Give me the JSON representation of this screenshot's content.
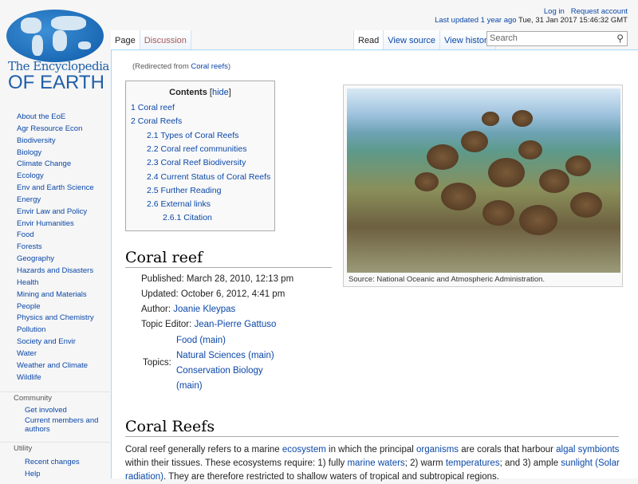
{
  "logo": {
    "line1": "The Encyclopedia",
    "line2": "OF EARTH"
  },
  "header": {
    "login": "Log in",
    "request_account": "Request account",
    "last_updated_label": "Last updated",
    "last_updated_ago": "1 year ago",
    "last_updated_date": "Tue, 31 Jan 2017 15:46:32 GMT"
  },
  "tabs": {
    "page": "Page",
    "discussion": "Discussion",
    "read": "Read",
    "view_source": "View source",
    "view_history": "View history"
  },
  "search": {
    "placeholder": "Search",
    "icon": "search-icon"
  },
  "sidebar": {
    "items": [
      "About the EoE",
      "Agr Resource Econ",
      "Biodiversity",
      "Biology",
      "Climate Change",
      "Ecology",
      "Env and Earth Science",
      "Energy",
      "Envir Law and Policy",
      "Envir Humanities",
      "Food",
      "Forests",
      "Geography",
      "Hazards and Disasters",
      "Health",
      "Mining and Materials",
      "People",
      "Physics and Chemistry",
      "Pollution",
      "Society and Envir",
      "Water",
      "Weather and Climate",
      "Wildlife"
    ],
    "community": {
      "heading": "Community",
      "items": [
        "Get involved",
        "Current members and authors"
      ]
    },
    "utility": {
      "heading": "Utility",
      "items": [
        "Recent changes",
        "Help"
      ]
    }
  },
  "redirect": {
    "prefix": "(Redirected from ",
    "link": "Coral reefs",
    "suffix": ")"
  },
  "toc": {
    "title": "Contents",
    "hide": "hide",
    "entries": [
      {
        "num": "1",
        "label": "Coral reef"
      },
      {
        "num": "2",
        "label": "Coral Reefs"
      },
      {
        "num": "2.1",
        "label": "Types of Coral Reefs"
      },
      {
        "num": "2.2",
        "label": "Coral reef communities"
      },
      {
        "num": "2.3",
        "label": "Coral Reef Biodiversity"
      },
      {
        "num": "2.4",
        "label": "Current Status of Coral Reefs"
      },
      {
        "num": "2.5",
        "label": "Further Reading"
      },
      {
        "num": "2.6",
        "label": "External links"
      },
      {
        "num": "2.6.1",
        "label": "Citation"
      }
    ]
  },
  "figure": {
    "caption": "Source: National Oceanic and Atmospheric Administration."
  },
  "article": {
    "h1": "Coral reef",
    "published": "Published: March 28, 2010, 12:13 pm",
    "updated": "Updated: October 6, 2012, 4:41 pm",
    "author_label": "Author:",
    "author": "Joanie Kleypas",
    "editor_label": "Topic Editor:",
    "editor": "Jean-Pierre Gattuso",
    "topics_label": "Topics:",
    "topics": [
      "Food (main)",
      "Natural Sciences (main)",
      "Conservation Biology",
      "(main)"
    ],
    "h2": "Coral Reefs",
    "p": [
      "Coral reef generally refers to a marine ",
      "ecosystem",
      " in which the principal ",
      "organisms",
      " are corals that harbour ",
      "algal symbionts",
      " within their tissues. These ecosystems require: 1) fully ",
      "marine waters",
      "; 2) warm ",
      "temperatures",
      "; and 3) ample ",
      "sunlight (Solar radiation)",
      ". They are therefore restricted to shallow waters of tropical and subtropical regions."
    ]
  }
}
